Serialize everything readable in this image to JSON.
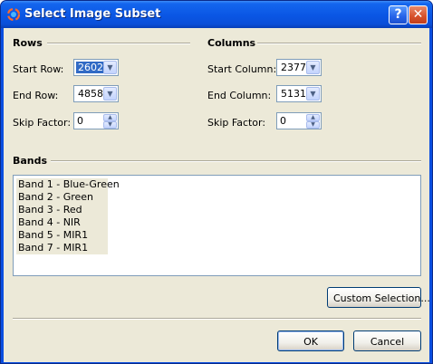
{
  "window": {
    "title": "Select Image Subset",
    "help_label": "?",
    "close_label": "✕"
  },
  "rows": {
    "title": "Rows",
    "start_label": "Start Row:",
    "start_value": "2602",
    "end_label": "End Row:",
    "end_value": "4858",
    "skip_label": "Skip Factor:",
    "skip_value": "0"
  },
  "columns": {
    "title": "Columns",
    "start_label": "Start Column:",
    "start_value": "2377",
    "end_label": "End Column:",
    "end_value": "5131",
    "skip_label": "Skip Factor:",
    "skip_value": "0"
  },
  "bands": {
    "title": "Bands",
    "items": [
      "Band 1 - Blue-Green",
      "Band 2 - Green",
      "Band 3 - Red",
      "Band 4 - NIR",
      "Band 5 - MIR1",
      "Band 7 - MIR1"
    ]
  },
  "buttons": {
    "custom_selection": "Custom Selection...",
    "ok": "OK",
    "cancel": "Cancel"
  },
  "icons": {
    "app": "globe-icon",
    "help": "help-icon",
    "close": "close-icon",
    "dropdown": "chevron-down-icon",
    "spin_up": "arrow-up-icon",
    "spin_down": "arrow-down-icon"
  },
  "colors": {
    "titlebar": "#0a56e4",
    "face": "#ece9d8",
    "selection": "#316ac5",
    "close": "#d6502a"
  }
}
